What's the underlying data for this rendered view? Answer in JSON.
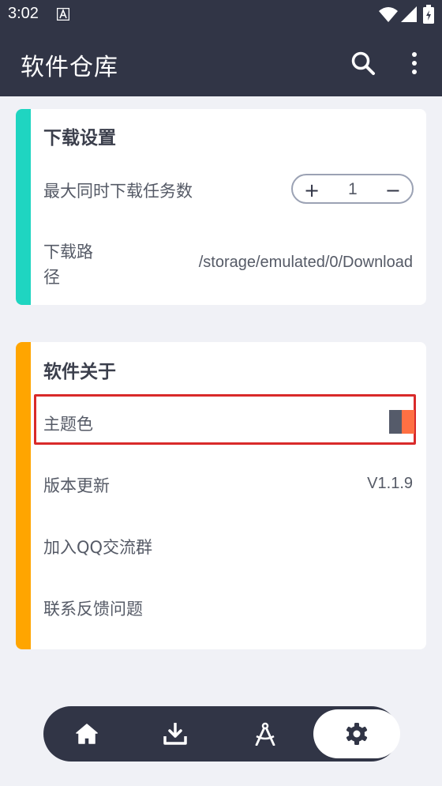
{
  "status_bar": {
    "time": "3:02"
  },
  "app_bar": {
    "title": "软件仓库"
  },
  "download_settings": {
    "title": "下载设置",
    "accent_color": "#1fd5c1",
    "max_tasks_label": "最大同时下载任务数",
    "max_tasks_value": "1",
    "path_label_line1": "下载路",
    "path_label_line2": "径",
    "path_value": "/storage/emulated/0/Download"
  },
  "about": {
    "title": "软件关于",
    "accent_color": "#ffa500",
    "theme_label": "主题色",
    "theme_colors": [
      "#555b6a",
      "#ff7043"
    ],
    "update_label": "版本更新",
    "version": "V1.1.9",
    "qq_label": "加入QQ交流群",
    "feedback_label": "联系反馈问题"
  },
  "bottom_nav": {
    "items": [
      {
        "icon": "home-icon"
      },
      {
        "icon": "download-icon"
      },
      {
        "icon": "compass-tool-icon"
      },
      {
        "icon": "settings-gear-icon",
        "active": true
      }
    ]
  },
  "colors": {
    "bar": "#313546",
    "background": "#f0f1f6",
    "highlight": "#d92a2a"
  }
}
